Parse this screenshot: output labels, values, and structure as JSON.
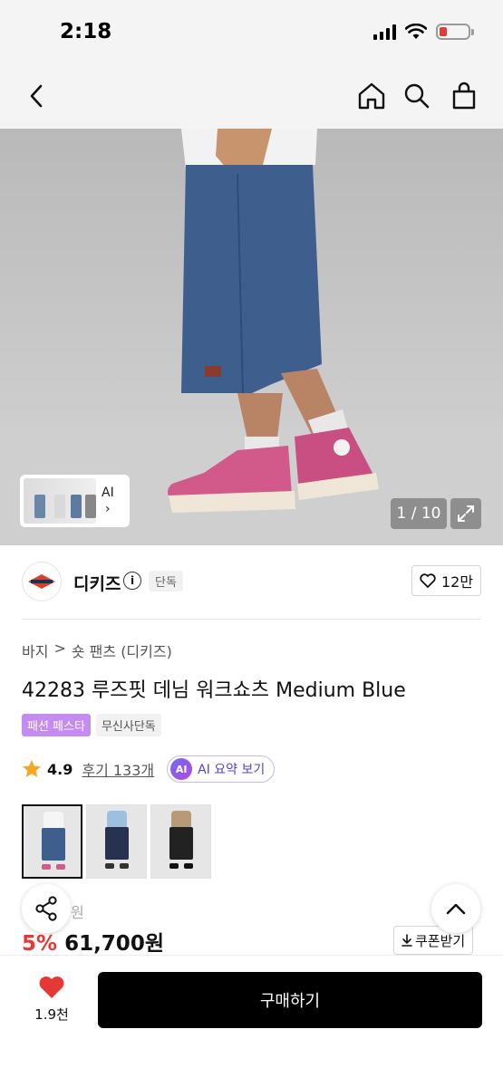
{
  "status_bar": {
    "time": "2:18"
  },
  "hero": {
    "page_current": "1",
    "page_total": "10",
    "page_separator": "/",
    "ai_label": "AI",
    "ai_arrow": "›"
  },
  "brand": {
    "name": "디키즈",
    "info": "i",
    "tag": "단독",
    "likes": "12만"
  },
  "product": {
    "breadcrumb": [
      "바지",
      ">",
      "숏 팬츠 (디키즈)"
    ],
    "title": "42283 루즈핏 데님 워크쇼츠 Medium Blue",
    "badge_festa": "패션 페스타",
    "badge_exclusive": "무신사단독",
    "rating": "4.9",
    "reviews": "후기 133개",
    "ai_badge": "AI",
    "ai_summary": "AI 요약 보기",
    "original_price": "원",
    "discount": "5%",
    "price": "61,700원",
    "coupon": "쿠폰받기"
  },
  "colors": {
    "accent_red": "#e53935",
    "festa_purple": "#c48bf0",
    "ai_purple": "#5b3fc7"
  },
  "bottom_bar": {
    "wish_count": "1.9천",
    "buy_label": "구매하기"
  }
}
